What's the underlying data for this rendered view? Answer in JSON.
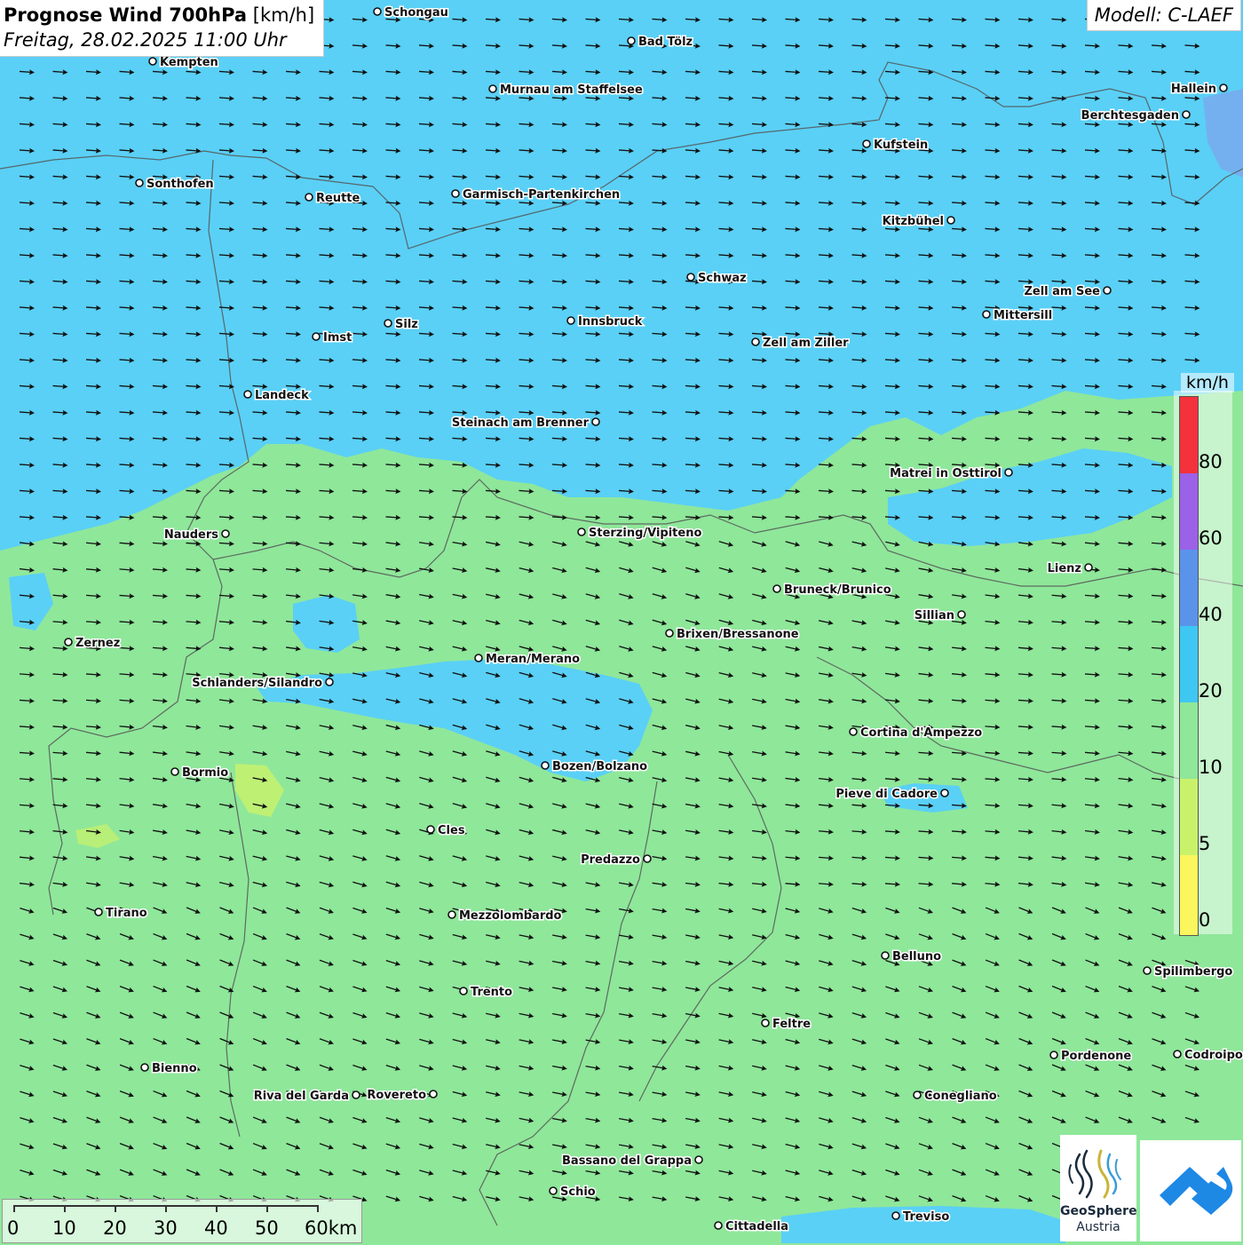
{
  "header": {
    "title_bold": "Prognose Wind 700hPa",
    "title_unit": "[km/h]",
    "datetime": "Freitag, 28.02.2025 11:00 Uhr"
  },
  "model": {
    "label": "Modell: C-LAEF"
  },
  "legend": {
    "unit": "km/h",
    "labels": [
      "80",
      "60",
      "40",
      "20",
      "10",
      "5",
      "0"
    ],
    "colors": {
      "c0_5": "#fbf55e",
      "c5_10": "#c9f26a",
      "c10_20": "#8fe79a",
      "c20_40": "#3ec7f2",
      "c40_60": "#5b93ea",
      "c60_80": "#9b61e7",
      "c80_plus": "#f3323c"
    }
  },
  "scalebar": {
    "labels": [
      "0",
      "10",
      "20",
      "30",
      "40",
      "50",
      "60km"
    ]
  },
  "logos": {
    "geosphere_name": "GeoSphere",
    "geosphere_sub": "Austria"
  },
  "map_colors": {
    "weak": "#8fe79a",
    "moderate": "#5ad0f6",
    "dark": "#7aa8ee",
    "border": "#555555"
  },
  "cities": [
    {
      "name": "Schongau"
    },
    {
      "name": "Bad Tölz"
    },
    {
      "name": "Kempten"
    },
    {
      "name": "Murnau am Staffelsee"
    },
    {
      "name": "Hallein"
    },
    {
      "name": "Berchtesgaden"
    },
    {
      "name": "Kufstein"
    },
    {
      "name": "Sonthofen"
    },
    {
      "name": "Reutte"
    },
    {
      "name": "Garmisch-Partenkirchen"
    },
    {
      "name": "Kitzbühel"
    },
    {
      "name": "Schwaz"
    },
    {
      "name": "Zell am See"
    },
    {
      "name": "Mittersill"
    },
    {
      "name": "Innsbruck"
    },
    {
      "name": "Silz"
    },
    {
      "name": "Imst"
    },
    {
      "name": "Zell am Ziller"
    },
    {
      "name": "Landeck"
    },
    {
      "name": "Steinach am Brenner"
    },
    {
      "name": "Matrei in Osttirol"
    },
    {
      "name": "Nauders"
    },
    {
      "name": "Sterzing/Vipiteno"
    },
    {
      "name": "Lienz"
    },
    {
      "name": "Bruneck/Brunico"
    },
    {
      "name": "Sillian"
    },
    {
      "name": "Zernez"
    },
    {
      "name": "Brixen/Bressanone"
    },
    {
      "name": "Meran/Merano"
    },
    {
      "name": "Schlanders/Silandro"
    },
    {
      "name": "Cortina d'Ampezzo"
    },
    {
      "name": "Bozen/Bolzano"
    },
    {
      "name": "Bormio"
    },
    {
      "name": "Pieve di Cadore"
    },
    {
      "name": "Cles"
    },
    {
      "name": "Predazzo"
    },
    {
      "name": "Tirano"
    },
    {
      "name": "Mezzolombardo"
    },
    {
      "name": "Belluno"
    },
    {
      "name": "Spilimbergo"
    },
    {
      "name": "Trento"
    },
    {
      "name": "Feltre"
    },
    {
      "name": "Pordenone"
    },
    {
      "name": "Codroipo"
    },
    {
      "name": "Bienno"
    },
    {
      "name": "Riva del Garda"
    },
    {
      "name": "Rovereto"
    },
    {
      "name": "Conegliano"
    },
    {
      "name": "Bassano del Grappa"
    },
    {
      "name": "Schio"
    },
    {
      "name": "Treviso"
    },
    {
      "name": "Cittadella"
    }
  ]
}
